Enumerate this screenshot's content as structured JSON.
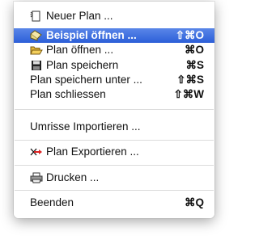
{
  "menu": {
    "items": [
      {
        "label": "Neuer Plan ...",
        "shortcut": "",
        "icon": "new-document-icon"
      },
      {
        "label": "Beispiel öffnen ...",
        "shortcut": "⇧⌘O",
        "icon": "open-example-icon"
      },
      {
        "label": "Plan öffnen ...",
        "shortcut": "⌘O",
        "icon": "open-folder-icon"
      },
      {
        "label": "Plan speichern",
        "shortcut": "⌘S",
        "icon": "save-disk-icon"
      },
      {
        "label": "Plan speichern unter ...",
        "shortcut": "⇧⌘S",
        "icon": ""
      },
      {
        "label": "Plan schliessen",
        "shortcut": "⇧⌘W",
        "icon": ""
      },
      {
        "label": "Umrisse Importieren ...",
        "shortcut": "",
        "icon": ""
      },
      {
        "label": "Plan Exportieren ...",
        "shortcut": "",
        "icon": "export-icon"
      },
      {
        "label": "Drucken ...",
        "shortcut": "",
        "icon": "printer-icon"
      },
      {
        "label": "Beenden",
        "shortcut": "⌘Q",
        "icon": ""
      }
    ],
    "highlighted_index": 1,
    "colors": {
      "highlight_top": "#5a86e8",
      "highlight_bottom": "#2c5fd8",
      "text": "#111111",
      "separator": "#dcdcdc"
    }
  }
}
